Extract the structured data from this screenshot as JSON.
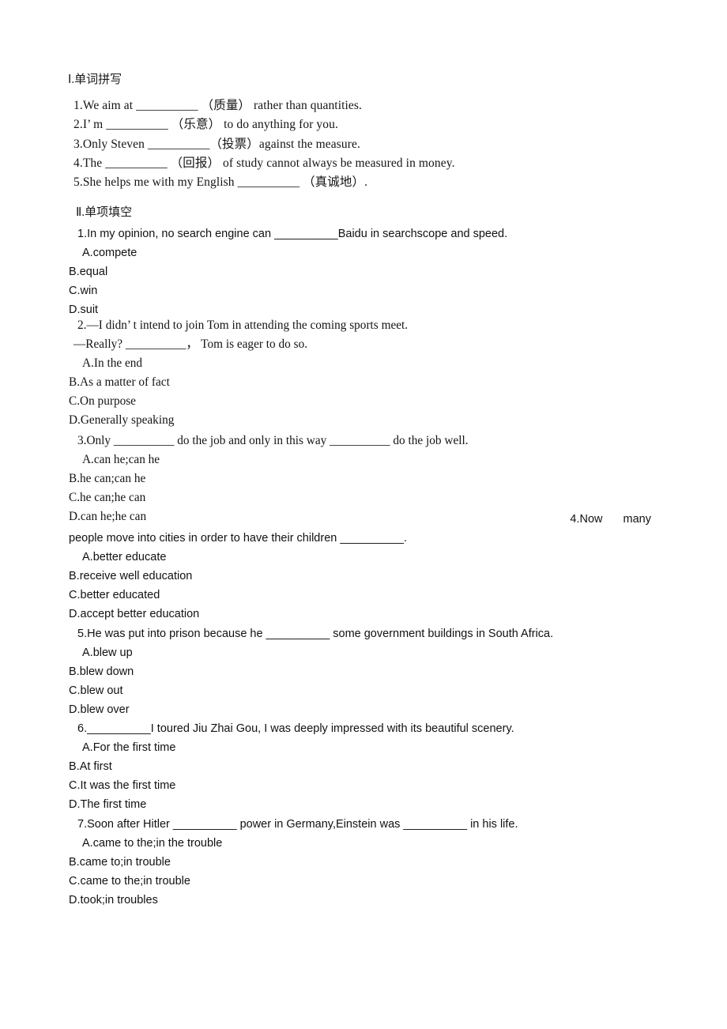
{
  "document": {
    "sections": [
      {
        "id": "word-spelling",
        "heading": "Ⅰ.单词拼写",
        "items": [
          "1.We aim at __________ （质量） rather than quantities.",
          "2.I’ m __________ （乐意） to do anything for you.",
          "3.Only Steven __________（投票）against the measure.",
          "4.The __________ （回报） of study cannot always be measured in money.",
          "5.She helps me with my English __________ （真诚地）."
        ]
      },
      {
        "id": "multiple-choice",
        "heading": "Ⅱ.单项填空",
        "questions": [
          {
            "number": "1",
            "stem": "1.In my opinion, no search engine can __________Baidu in searchscope and speed.",
            "font": "sans",
            "options": [
              "A.compete",
              "B.equal",
              "C.win",
              "D.suit"
            ]
          },
          {
            "number": "2",
            "stem_line1": "2.—I didn’ t intend to join Tom in attending the coming sports meet.",
            "stem_line2": "—Really? __________， Tom is eager to do so.",
            "font": "serif",
            "options": [
              "A.In the end",
              "B.As a matter of fact",
              "C.On purpose",
              "D.Generally speaking"
            ]
          },
          {
            "number": "3",
            "stem": "3.Only __________ do the job and only in this way __________ do the job well.",
            "font": "serif",
            "options": [
              "A.can he;can he",
              "B.he can;can he",
              "C.he can;he can",
              "D.can he;he can"
            ]
          },
          {
            "number": "4",
            "stem_fragment": "4.Now",
            "stem_fragment2": "many",
            "stem_continued": "people move into cities in order to have their children __________.",
            "font": "sans",
            "options": [
              "A.better educate",
              "B.receive well education",
              "C.better educated",
              "D.accept better education"
            ]
          },
          {
            "number": "5",
            "stem": "5.He was put into prison because he __________ some government buildings in South Africa.",
            "font": "sans",
            "options": [
              "A.blew up",
              "B.blew down",
              "C.blew out",
              "D.blew over"
            ]
          },
          {
            "number": "6",
            "stem": "6.__________I toured Jiu Zhai Gou, I was deeply impressed with its beautiful scenery.",
            "font": "sans",
            "options": [
              "A.For the first time",
              "B.At first",
              "C.It was the first time",
              "D.The first time"
            ]
          },
          {
            "number": "7",
            "stem": "7.Soon after Hitler __________ power in Germany,Einstein was __________ in his life.",
            "font": "sans",
            "options": [
              "A.came to the;in the trouble",
              "B.came to;in trouble",
              "C.came to the;in trouble",
              "D.took;in troubles"
            ]
          }
        ]
      }
    ]
  },
  "colors": {
    "page_background": "#ffffff",
    "body_text": "#111111",
    "heading_text": "#1a1a1a"
  }
}
